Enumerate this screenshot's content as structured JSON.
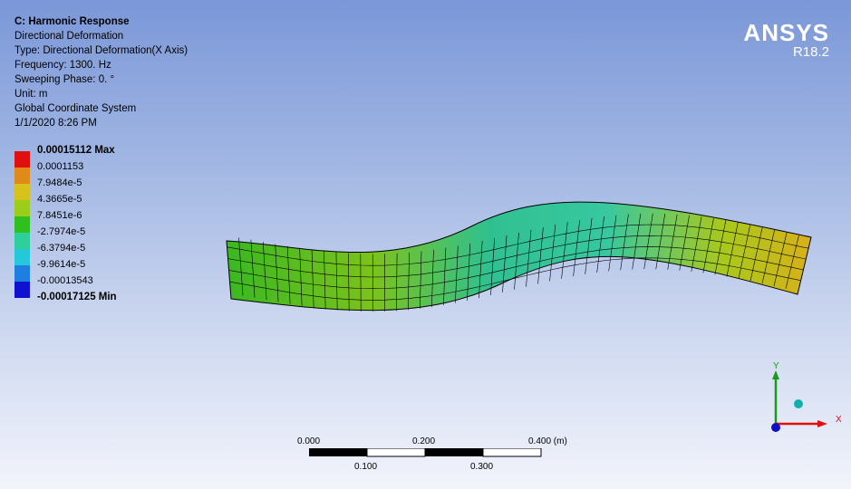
{
  "info": {
    "title": "C: Harmonic Response",
    "lines": [
      "Directional Deformation",
      "Type: Directional Deformation(X Axis)",
      "Frequency: 1300. Hz",
      "Sweeping Phase: 0. °",
      "Unit: m",
      "Global Coordinate System",
      "1/1/2020 8:26 PM"
    ]
  },
  "brand": {
    "name": "ANSYS",
    "version": "R18.2"
  },
  "legend": {
    "max_label": "0.00015112 Max",
    "values": [
      "0.0001153",
      "7.9484e-5",
      "4.3665e-5",
      "7.8451e-6",
      "-2.7974e-5",
      "-6.3794e-5",
      "-9.9614e-5",
      "-0.00013543"
    ],
    "min_label": "-0.00017125 Min",
    "colors": [
      "#e01010",
      "#e08a1a",
      "#d6c21a",
      "#9ccd1a",
      "#2fbf1e",
      "#2ecf9a",
      "#24c8d8",
      "#1f7fe0",
      "#1010d0"
    ]
  },
  "scale_bar": {
    "top_labels": [
      "0.000",
      "0.200",
      "0.400 (m)"
    ],
    "bottom_labels": [
      "0.100",
      "0.300"
    ]
  },
  "triad": {
    "x_label": "X",
    "y_label": "Y",
    "colors": {
      "x": "#e01010",
      "y": "#1a9a1a",
      "z": "#1010c0",
      "iso": "#10b0b0"
    }
  }
}
